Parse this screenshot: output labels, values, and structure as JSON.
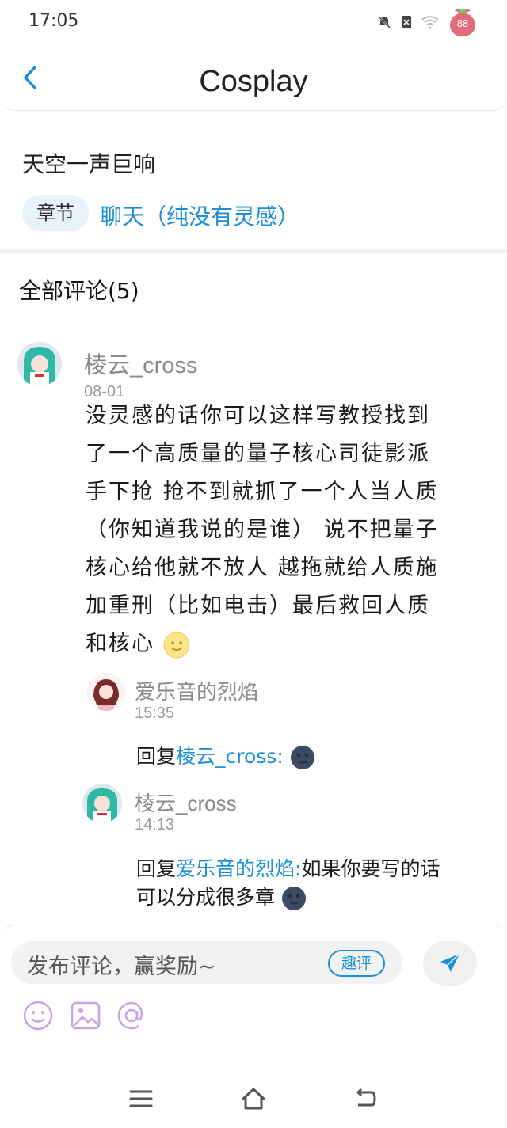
{
  "status_bar": {
    "time": "17:05",
    "battery": "88"
  },
  "header": {
    "title": "Cosplay"
  },
  "chapter": {
    "title": "天空一声巨响",
    "tag": "章节",
    "name": "聊天（纯没有灵感）"
  },
  "comments_section": {
    "title": "全部评论(5)"
  },
  "comment": {
    "author": "棱云_cross",
    "date": "08-01",
    "lines": [
      "没灵感的话你可以这样写教授找到",
      "了一个高质量的量子核心司徒影派",
      "手下抢 抢不到就抓了一个人当人质",
      "（你知道我说的是谁） 说不把量子",
      "核心给他就不放人 越拖就给人质施",
      "加重刑（比如电击）最后救回人质",
      "和核心"
    ],
    "emoji": "slightly-smiling-moon-face"
  },
  "replies": [
    {
      "author": "爱乐音的烈焰",
      "time": "15:35",
      "prefix": "回复",
      "target": "棱云_cross:",
      "text": "",
      "emoji": "new-moon-face"
    },
    {
      "author": "棱云_cross",
      "time": "14:13",
      "prefix": "回复",
      "target": "爱乐音的烈焰:",
      "text": "如果你要写的话",
      "text2": "可以分成很多章",
      "emoji": "new-moon-face"
    }
  ],
  "comment_bar": {
    "placeholder": "发布评论，赢奖励~",
    "fun_badge": "趣评"
  },
  "colors": {
    "link": "#1a8ed6",
    "accent_bg": "#e6f3fb"
  }
}
